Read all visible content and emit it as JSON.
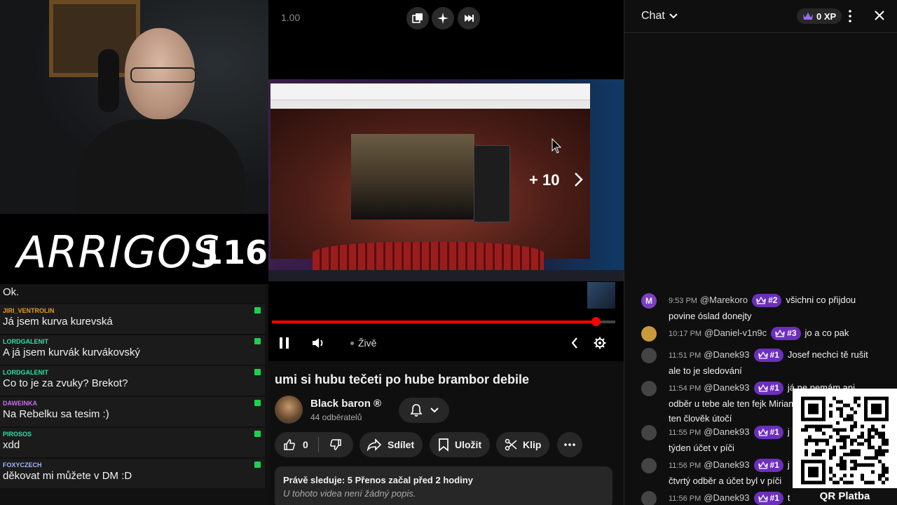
{
  "overlay": {
    "brand_name": "ARRIGOS",
    "brand_number": "116",
    "chat": [
      {
        "user": "",
        "text": "Ok.",
        "user_color": "#e0e0e0"
      },
      {
        "user": "JIRI_VENTROLIN",
        "text": "Já jsem kurva kurevská",
        "user_color": "#e89a1e"
      },
      {
        "user": "LORDGALENIT",
        "text": "A já jsem kurvák kurvákovský",
        "user_color": "#2fe0a8"
      },
      {
        "user": "LORDGALENIT",
        "text": "Co to je za zvuky? Brekot?",
        "user_color": "#2fe0a8"
      },
      {
        "user": "DAWEINKA",
        "text": "Na Rebelku sa tesim :)",
        "user_color": "#c86cf0"
      },
      {
        "user": "PIROSOS",
        "text": "xdd",
        "user_color": "#2fe0a8"
      },
      {
        "user": "FOXYCZECH",
        "text": "děkovat mi můžete v DM :D",
        "user_color": "#9fb7ff"
      }
    ]
  },
  "player": {
    "speed_label": "1.00",
    "skip_label": "+ 10",
    "live_label": "Živě",
    "progress_fraction": 0.945
  },
  "video": {
    "title": "umi si hubu tečeti po hube brambor debile",
    "channel_name": "Black baron ®",
    "subscribers": "44 odběratelů",
    "like_count": "0",
    "share_label": "Sdílet",
    "save_label": "Uložit",
    "clip_label": "Klip",
    "watching_line": "Právě sleduje: 5  Přenos začal před 2 hodiny",
    "description_empty": "U tohoto videa není žádný popis."
  },
  "chat": {
    "title": "Chat",
    "xp_label": "0 XP",
    "accent": "#6c2fbd",
    "messages": [
      {
        "avatar_letter": "M",
        "avatar_color": "#7b3fbf",
        "time": "9:53 PM",
        "author": "@Marekoro",
        "rank": "#2",
        "text": "všichni co přijdou",
        "cont": "povine óslad donejty"
      },
      {
        "avatar_letter": "",
        "avatar_color": "#c99a3b",
        "time": "10:17 PM",
        "author": "@Daniel-v1n9c",
        "rank": "#3",
        "text": "jo a co pak",
        "cont": ""
      },
      {
        "avatar_letter": "",
        "avatar_color": "#444444",
        "time": "11:51 PM",
        "author": "@Danek93",
        "rank": "#1",
        "text": "Josef nechci tě rušit",
        "cont": "ale to je sledování"
      },
      {
        "avatar_letter": "",
        "avatar_color": "#444444",
        "time": "11:54 PM",
        "author": "@Danek93",
        "rank": "#1",
        "text": "já ne nemám ani",
        "cont": "odběr u tebe ale ten fejk Miriam",
        "cont2": "ten člověk útočí"
      },
      {
        "avatar_letter": "",
        "avatar_color": "#444444",
        "time": "11:55 PM",
        "author": "@Danek93",
        "rank": "#1",
        "text": "j",
        "cont": "týden účet v píči"
      },
      {
        "avatar_letter": "",
        "avatar_color": "#444444",
        "time": "11:56 PM",
        "author": "@Danek93",
        "rank": "#1",
        "text": "j",
        "cont": "čtvrtý odběr a účet byl v píči"
      },
      {
        "avatar_letter": "",
        "avatar_color": "#444444",
        "time": "11:56 PM",
        "author": "@Danek93",
        "rank": "#1",
        "text": "t",
        "cont": ""
      }
    ],
    "qr_label": "QR Platba"
  }
}
